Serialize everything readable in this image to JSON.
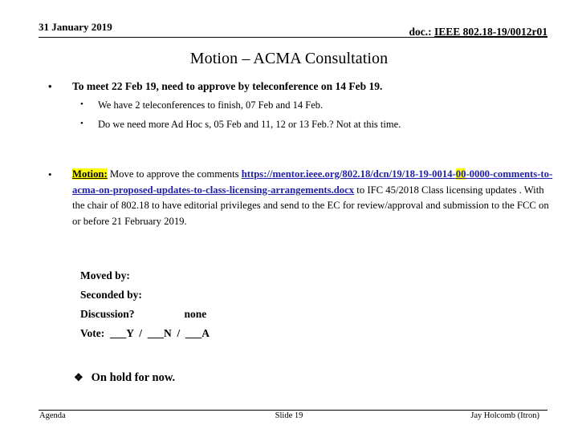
{
  "header": {
    "date": "31 January 2019",
    "doc_prefix": "doc.: ",
    "doc_number": "IEEE 802.18-19/0012r01"
  },
  "title": "Motion – ACMA Consultation",
  "bullets": {
    "marker_level1": "•",
    "marker_level2": "•",
    "meet": "To meet 22 Feb 19, need to approve by teleconference on 14 Feb 19.",
    "teleconferences": "We have 2 teleconferences to finish,  07 Feb and 14 Feb.",
    "adhoc": "Do we need more Ad Hoc s, 05 Feb and 11, 12 or 13 Feb.? Not at this time."
  },
  "motion": {
    "marker": "•",
    "lead": "Motion:",
    "intro": " Move to approve the comments ",
    "link_part1": "https://mentor.ieee.org/802.18/dcn/19/18-19-0014-",
    "link_highlight": "00",
    "link_part2": "-0000-comments-to-acma-on-proposed-updates-to-class-licensing-arrangements.docx",
    "tail": " to IFC 45/2018 Class licensing updates . With the chair of 802.18 to have editorial privileges and send to the EC for review/approval and submission to the FCC on or before 21 February 2019."
  },
  "vote": {
    "moved_by": "Moved by:",
    "seconded_by": "Seconded by:",
    "discussion_label": "Discussion?",
    "discussion_value": "none",
    "tally": "Vote:  ___Y  /  ___N  /  ___A"
  },
  "status": {
    "diamond": "❖",
    "text": "On hold for now."
  },
  "footer": {
    "left": "Agenda",
    "center": "Slide 19",
    "right": "Jay Holcomb (Itron)"
  },
  "colors": {
    "link": "#2222a8",
    "highlight": "#ffff00",
    "text": "#000000",
    "background": "#ffffff"
  }
}
